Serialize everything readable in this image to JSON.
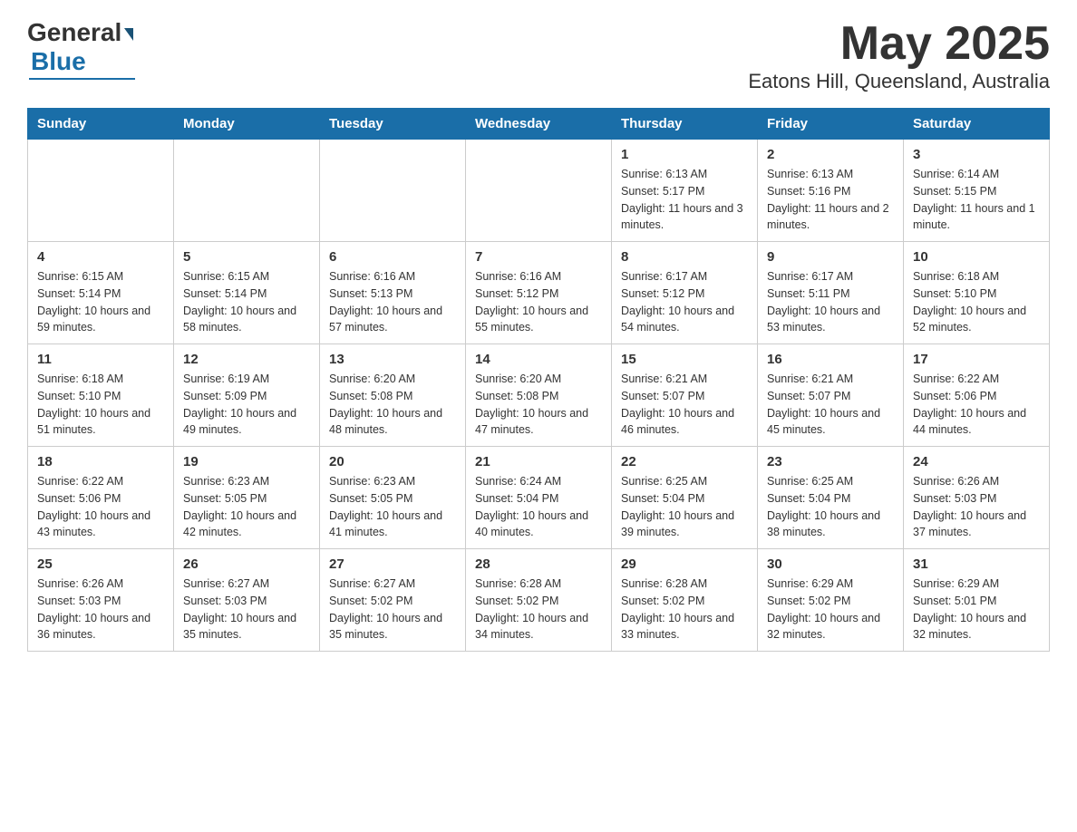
{
  "logo": {
    "text_general": "General",
    "text_blue": "Blue",
    "underline": "Blue"
  },
  "header": {
    "month_year": "May 2025",
    "location": "Eatons Hill, Queensland, Australia"
  },
  "weekdays": [
    "Sunday",
    "Monday",
    "Tuesday",
    "Wednesday",
    "Thursday",
    "Friday",
    "Saturday"
  ],
  "weeks": [
    [
      {
        "day": "",
        "info": ""
      },
      {
        "day": "",
        "info": ""
      },
      {
        "day": "",
        "info": ""
      },
      {
        "day": "",
        "info": ""
      },
      {
        "day": "1",
        "info": "Sunrise: 6:13 AM\nSunset: 5:17 PM\nDaylight: 11 hours and 3 minutes."
      },
      {
        "day": "2",
        "info": "Sunrise: 6:13 AM\nSunset: 5:16 PM\nDaylight: 11 hours and 2 minutes."
      },
      {
        "day": "3",
        "info": "Sunrise: 6:14 AM\nSunset: 5:15 PM\nDaylight: 11 hours and 1 minute."
      }
    ],
    [
      {
        "day": "4",
        "info": "Sunrise: 6:15 AM\nSunset: 5:14 PM\nDaylight: 10 hours and 59 minutes."
      },
      {
        "day": "5",
        "info": "Sunrise: 6:15 AM\nSunset: 5:14 PM\nDaylight: 10 hours and 58 minutes."
      },
      {
        "day": "6",
        "info": "Sunrise: 6:16 AM\nSunset: 5:13 PM\nDaylight: 10 hours and 57 minutes."
      },
      {
        "day": "7",
        "info": "Sunrise: 6:16 AM\nSunset: 5:12 PM\nDaylight: 10 hours and 55 minutes."
      },
      {
        "day": "8",
        "info": "Sunrise: 6:17 AM\nSunset: 5:12 PM\nDaylight: 10 hours and 54 minutes."
      },
      {
        "day": "9",
        "info": "Sunrise: 6:17 AM\nSunset: 5:11 PM\nDaylight: 10 hours and 53 minutes."
      },
      {
        "day": "10",
        "info": "Sunrise: 6:18 AM\nSunset: 5:10 PM\nDaylight: 10 hours and 52 minutes."
      }
    ],
    [
      {
        "day": "11",
        "info": "Sunrise: 6:18 AM\nSunset: 5:10 PM\nDaylight: 10 hours and 51 minutes."
      },
      {
        "day": "12",
        "info": "Sunrise: 6:19 AM\nSunset: 5:09 PM\nDaylight: 10 hours and 49 minutes."
      },
      {
        "day": "13",
        "info": "Sunrise: 6:20 AM\nSunset: 5:08 PM\nDaylight: 10 hours and 48 minutes."
      },
      {
        "day": "14",
        "info": "Sunrise: 6:20 AM\nSunset: 5:08 PM\nDaylight: 10 hours and 47 minutes."
      },
      {
        "day": "15",
        "info": "Sunrise: 6:21 AM\nSunset: 5:07 PM\nDaylight: 10 hours and 46 minutes."
      },
      {
        "day": "16",
        "info": "Sunrise: 6:21 AM\nSunset: 5:07 PM\nDaylight: 10 hours and 45 minutes."
      },
      {
        "day": "17",
        "info": "Sunrise: 6:22 AM\nSunset: 5:06 PM\nDaylight: 10 hours and 44 minutes."
      }
    ],
    [
      {
        "day": "18",
        "info": "Sunrise: 6:22 AM\nSunset: 5:06 PM\nDaylight: 10 hours and 43 minutes."
      },
      {
        "day": "19",
        "info": "Sunrise: 6:23 AM\nSunset: 5:05 PM\nDaylight: 10 hours and 42 minutes."
      },
      {
        "day": "20",
        "info": "Sunrise: 6:23 AM\nSunset: 5:05 PM\nDaylight: 10 hours and 41 minutes."
      },
      {
        "day": "21",
        "info": "Sunrise: 6:24 AM\nSunset: 5:04 PM\nDaylight: 10 hours and 40 minutes."
      },
      {
        "day": "22",
        "info": "Sunrise: 6:25 AM\nSunset: 5:04 PM\nDaylight: 10 hours and 39 minutes."
      },
      {
        "day": "23",
        "info": "Sunrise: 6:25 AM\nSunset: 5:04 PM\nDaylight: 10 hours and 38 minutes."
      },
      {
        "day": "24",
        "info": "Sunrise: 6:26 AM\nSunset: 5:03 PM\nDaylight: 10 hours and 37 minutes."
      }
    ],
    [
      {
        "day": "25",
        "info": "Sunrise: 6:26 AM\nSunset: 5:03 PM\nDaylight: 10 hours and 36 minutes."
      },
      {
        "day": "26",
        "info": "Sunrise: 6:27 AM\nSunset: 5:03 PM\nDaylight: 10 hours and 35 minutes."
      },
      {
        "day": "27",
        "info": "Sunrise: 6:27 AM\nSunset: 5:02 PM\nDaylight: 10 hours and 35 minutes."
      },
      {
        "day": "28",
        "info": "Sunrise: 6:28 AM\nSunset: 5:02 PM\nDaylight: 10 hours and 34 minutes."
      },
      {
        "day": "29",
        "info": "Sunrise: 6:28 AM\nSunset: 5:02 PM\nDaylight: 10 hours and 33 minutes."
      },
      {
        "day": "30",
        "info": "Sunrise: 6:29 AM\nSunset: 5:02 PM\nDaylight: 10 hours and 32 minutes."
      },
      {
        "day": "31",
        "info": "Sunrise: 6:29 AM\nSunset: 5:01 PM\nDaylight: 10 hours and 32 minutes."
      }
    ]
  ]
}
